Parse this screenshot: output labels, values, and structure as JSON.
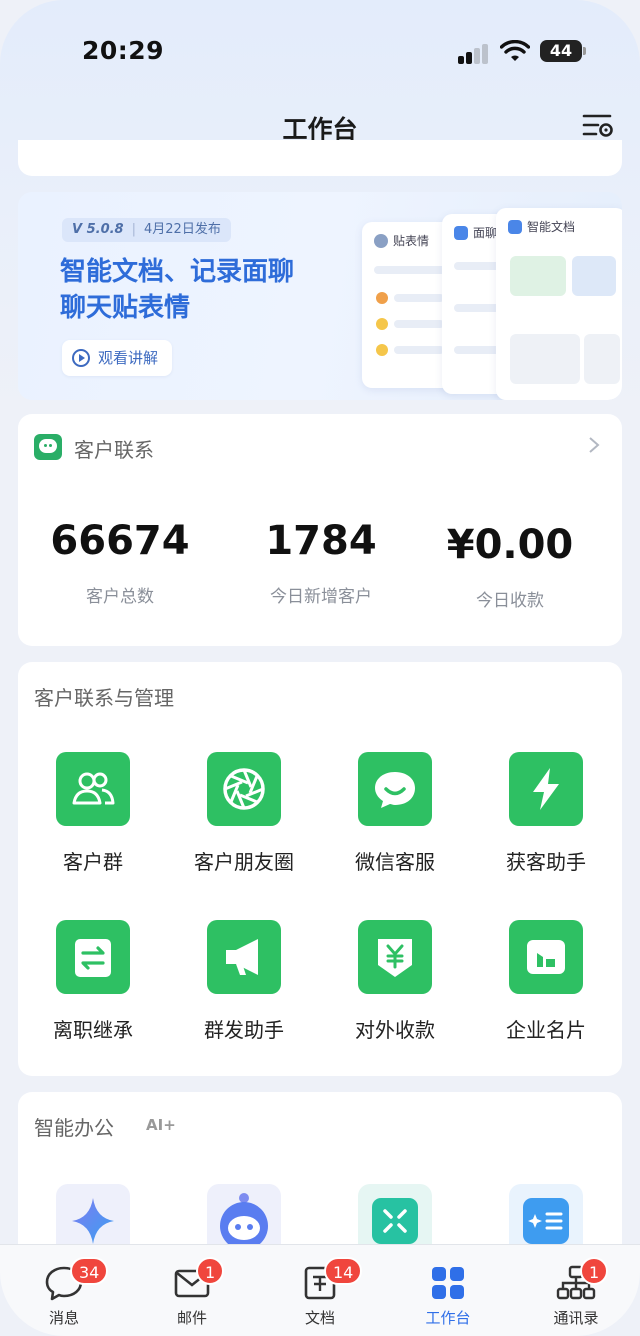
{
  "status_bar": {
    "time": "20:29",
    "battery": "44"
  },
  "nav": {
    "title": "工作台"
  },
  "banner": {
    "version": "V 5.0.8",
    "release_date": "4月22日发布",
    "title_line1": "智能文档、记录面聊",
    "title_line2": "聊天贴表情",
    "watch_label": "观看讲解",
    "mock1_title": "贴表情",
    "mock2_title": "面聊",
    "mock3_title": "智能文档"
  },
  "customer": {
    "title": "客户联系",
    "stats": [
      {
        "value": "66674",
        "label": "客户总数"
      },
      {
        "value": "1784",
        "label": "今日新增客户"
      },
      {
        "value": "¥0.00",
        "label": "今日收款"
      }
    ]
  },
  "management": {
    "title": "客户联系与管理",
    "items": [
      {
        "label": "客户群",
        "icon": "customer-group-icon"
      },
      {
        "label": "客户朋友圈",
        "icon": "moments-aperture-icon"
      },
      {
        "label": "微信客服",
        "icon": "chat-smile-icon"
      },
      {
        "label": "获客助手",
        "icon": "lightning-icon"
      },
      {
        "label": "离职继承",
        "icon": "transfer-arrows-icon"
      },
      {
        "label": "群发助手",
        "icon": "megaphone-icon"
      },
      {
        "label": "对外收款",
        "icon": "yuan-shield-icon"
      },
      {
        "label": "企业名片",
        "icon": "business-card-icon"
      }
    ]
  },
  "ai_office": {
    "title": "智能办公",
    "badge": "AI+"
  },
  "tabbar": {
    "tabs": [
      {
        "label": "消息",
        "badge": "34"
      },
      {
        "label": "邮件",
        "badge": "1"
      },
      {
        "label": "文档",
        "badge": "14"
      },
      {
        "label": "工作台",
        "badge": ""
      },
      {
        "label": "通讯录",
        "badge": "1"
      }
    ],
    "active_color": "#2f6fe8"
  },
  "colors": {
    "accent_green": "#2ec063",
    "badge_red": "#f0463d",
    "banner_blue": "#2e6cd9"
  }
}
